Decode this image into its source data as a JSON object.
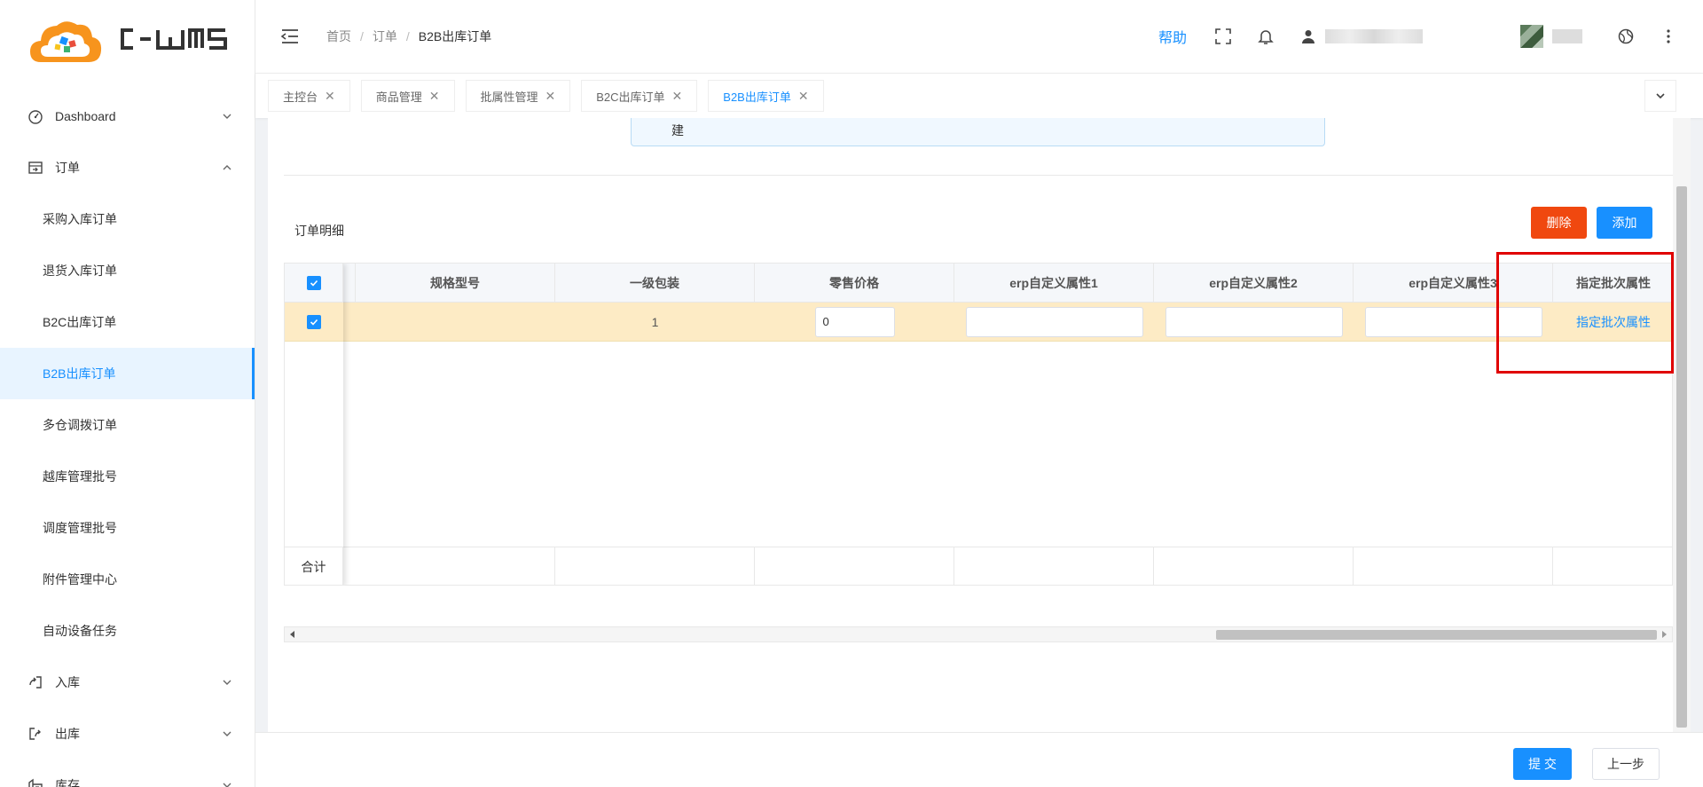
{
  "logo": {
    "text": "C-WMS",
    "colors": {
      "cloud": "#f7941d",
      "accent": "#1890ff"
    }
  },
  "sidebar": {
    "groups": [
      {
        "label": "Dashboard",
        "icon": "dashboard-icon",
        "expanded": false
      },
      {
        "label": "订单",
        "icon": "order-icon",
        "expanded": true
      },
      {
        "label": "入库",
        "icon": "inbound-icon",
        "expanded": false
      },
      {
        "label": "出库",
        "icon": "outbound-icon",
        "expanded": false
      },
      {
        "label": "库存",
        "icon": "inventory-icon",
        "expanded": false
      }
    ],
    "order_items": [
      {
        "label": "采购入库订单"
      },
      {
        "label": "退货入库订单"
      },
      {
        "label": "B2C出库订单"
      },
      {
        "label": "B2B出库订单",
        "active": true
      },
      {
        "label": "多仓调拨订单"
      },
      {
        "label": "越库管理批号"
      },
      {
        "label": "调度管理批号"
      },
      {
        "label": "附件管理中心"
      },
      {
        "label": "自动设备任务"
      }
    ]
  },
  "header": {
    "breadcrumb": [
      "首页",
      "订单",
      "B2B出库订单"
    ],
    "help": "帮助"
  },
  "tabs": [
    {
      "label": "主控台"
    },
    {
      "label": "商品管理"
    },
    {
      "label": "批属性管理"
    },
    {
      "label": "B2C出库订单"
    },
    {
      "label": "B2B出库订单",
      "active": true
    }
  ],
  "main": {
    "info_text": "建",
    "section_title": "订单明细",
    "delete_label": "删除",
    "add_label": "添加",
    "table": {
      "columns": [
        "规格型号",
        "一级包装",
        "零售价格",
        "erp自定义属性1",
        "erp自定义属性2",
        "erp自定义属性3",
        "指定批次属性"
      ],
      "row": {
        "spec": "",
        "package": "1",
        "price": "0",
        "erp1": "",
        "erp2": "",
        "erp3": "",
        "batch_link": "指定批次属性"
      },
      "footer": "合计"
    }
  },
  "bottom": {
    "submit": "提 交",
    "prev": "上一步"
  }
}
